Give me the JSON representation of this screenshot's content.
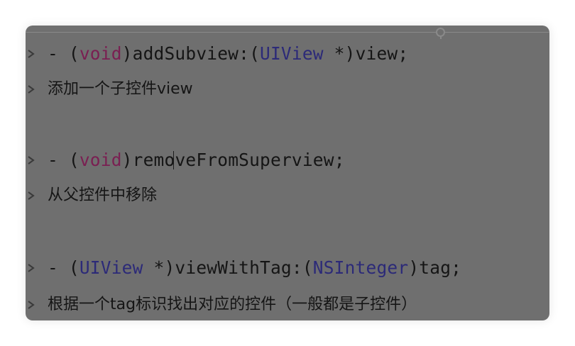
{
  "colors": {
    "page_background": "#ffffff",
    "panel_background": "#6f6f6f",
    "text": "#151515",
    "keyword": "#7a1f52",
    "type_name": "#2c2a78"
  },
  "icons": {
    "disclosure": "chevron-right-icon",
    "ruler_handle": "ruler-handle-icon"
  },
  "methods": [
    {
      "signature": {
        "prefix": "- (",
        "keyword": "void",
        "name": ")addSubview:(",
        "type": "UIView",
        "suffix": " *)view;"
      },
      "description": "添加一个子控件view"
    },
    {
      "signature": {
        "prefix": "- (",
        "keyword": "void",
        "name_before_cursor": ")remo",
        "name_after_cursor": "veFromSuperview;"
      },
      "description": "从父控件中移除"
    },
    {
      "signature": {
        "prefix": "- (",
        "type": "UIView",
        "middle": " *)viewWithTag:(",
        "param_type": "NSInteger",
        "suffix": ")tag;"
      },
      "description": "根据一个tag标识找出对应的控件（一般都是子控件）"
    }
  ]
}
